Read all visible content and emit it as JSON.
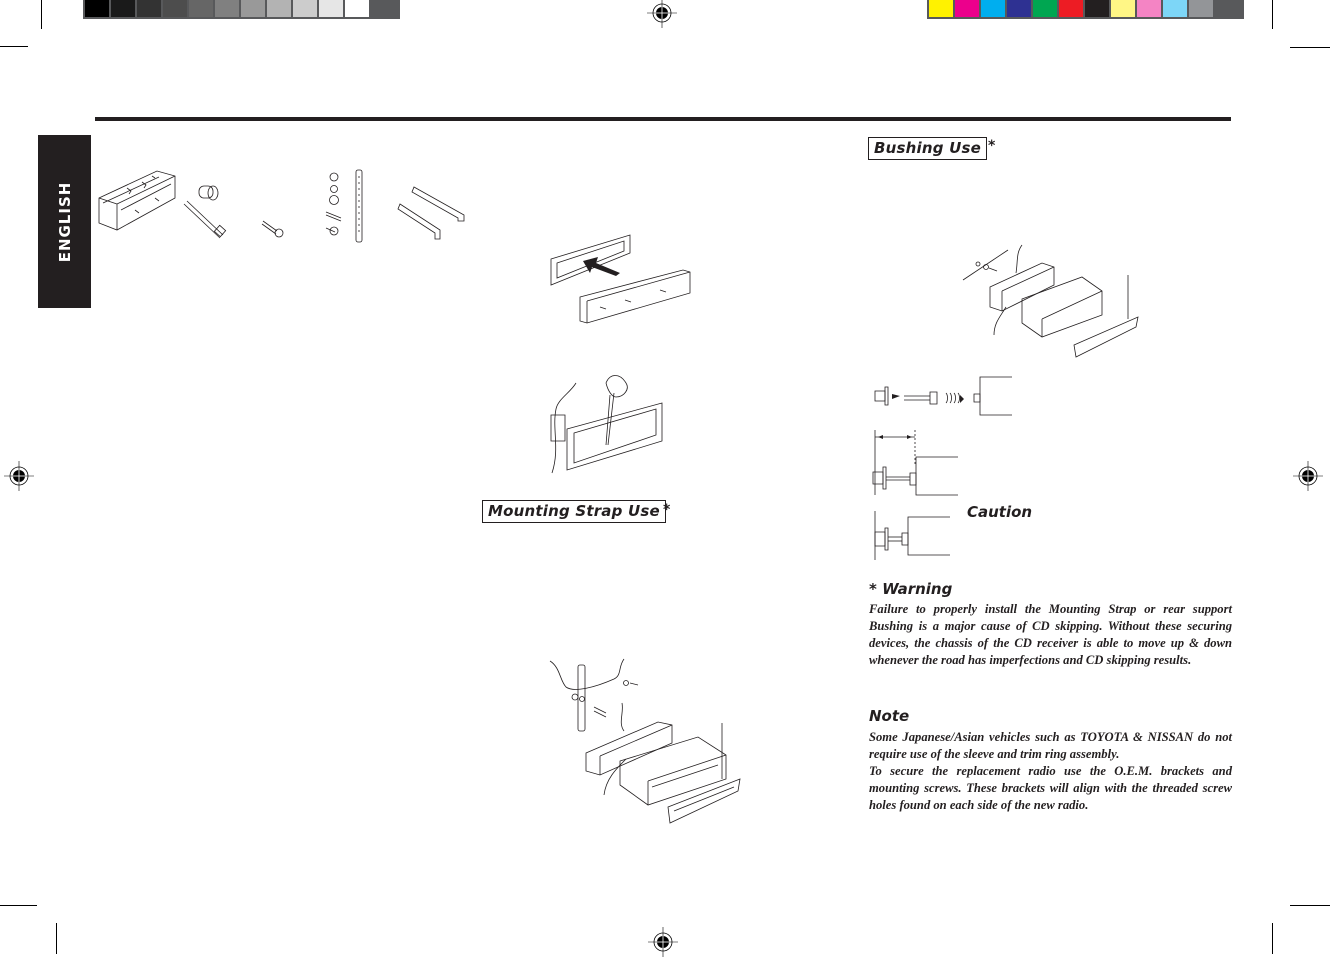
{
  "print_marks": {
    "grayscale_bar": [
      "#000000",
      "#1a1a1a",
      "#333333",
      "#4d4d4d",
      "#666666",
      "#808080",
      "#999999",
      "#b3b3b3",
      "#cccccc",
      "#e6e6e6",
      "#ffffff"
    ],
    "color_bar": [
      "#fff200",
      "#ec008c",
      "#00aeef",
      "#2e3192",
      "#00a651",
      "#ed1c24",
      "#231f20",
      "#fff685",
      "#f484c4",
      "#7dd6f7",
      "#939598"
    ]
  },
  "language_tab": "ENGLISH",
  "sections": {
    "mounting_strap": {
      "title": "Mounting Strap Use",
      "marker": "*"
    },
    "bushing": {
      "title": "Bushing Use",
      "marker": "*"
    }
  },
  "caution_label": "Caution",
  "warning": {
    "title": "* Warning",
    "text": "Failure to properly install the Mounting Strap or rear support Bushing is a major cause of CD skipping. Without these securing devices, the chassis of the CD receiver is able to move up & down whenever the road has imperfections and CD skipping results."
  },
  "note": {
    "title": "Note",
    "paragraphs": [
      "Some Japanese/Asian vehicles such as TOYOTA & NISSAN do not require use of the sleeve and trim ring assembly.",
      "To secure the replacement radio use the O.E.M. brackets and mounting screws. These brackets will align with the threaded screw holes found on each side of the new radio."
    ]
  },
  "illustrations": [
    "mounting-sleeve",
    "bushing-and-bolt",
    "screw",
    "strap-hardware-set",
    "removal-keys",
    "trim-ring-onto-sleeve",
    "sleeve-tabs-bent-with-screwdriver",
    "mounting-strap-assembly",
    "bushing-assembly",
    "bushing-steps"
  ]
}
